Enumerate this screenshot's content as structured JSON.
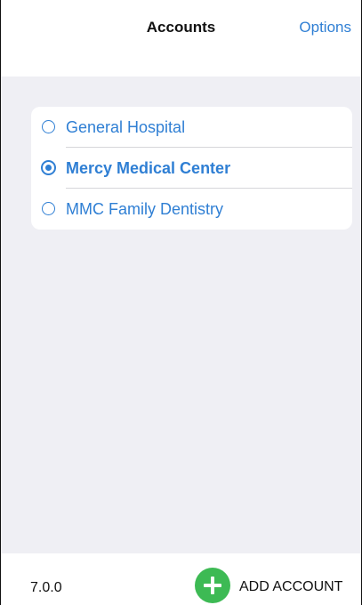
{
  "header": {
    "title": "Accounts",
    "options_label": "Options"
  },
  "accounts": {
    "items": [
      {
        "name": "General Hospital",
        "selected": false
      },
      {
        "name": "Mercy Medical Center",
        "selected": true
      },
      {
        "name": "MMC Family Dentistry",
        "selected": false
      }
    ]
  },
  "footer": {
    "version": "7.0.0",
    "add_account_label": "ADD ACCOUNT",
    "add_icon": "plus-icon"
  },
  "colors": {
    "accent": "#2f7fd4",
    "add_button": "#3dba54",
    "background": "#efeff4"
  }
}
